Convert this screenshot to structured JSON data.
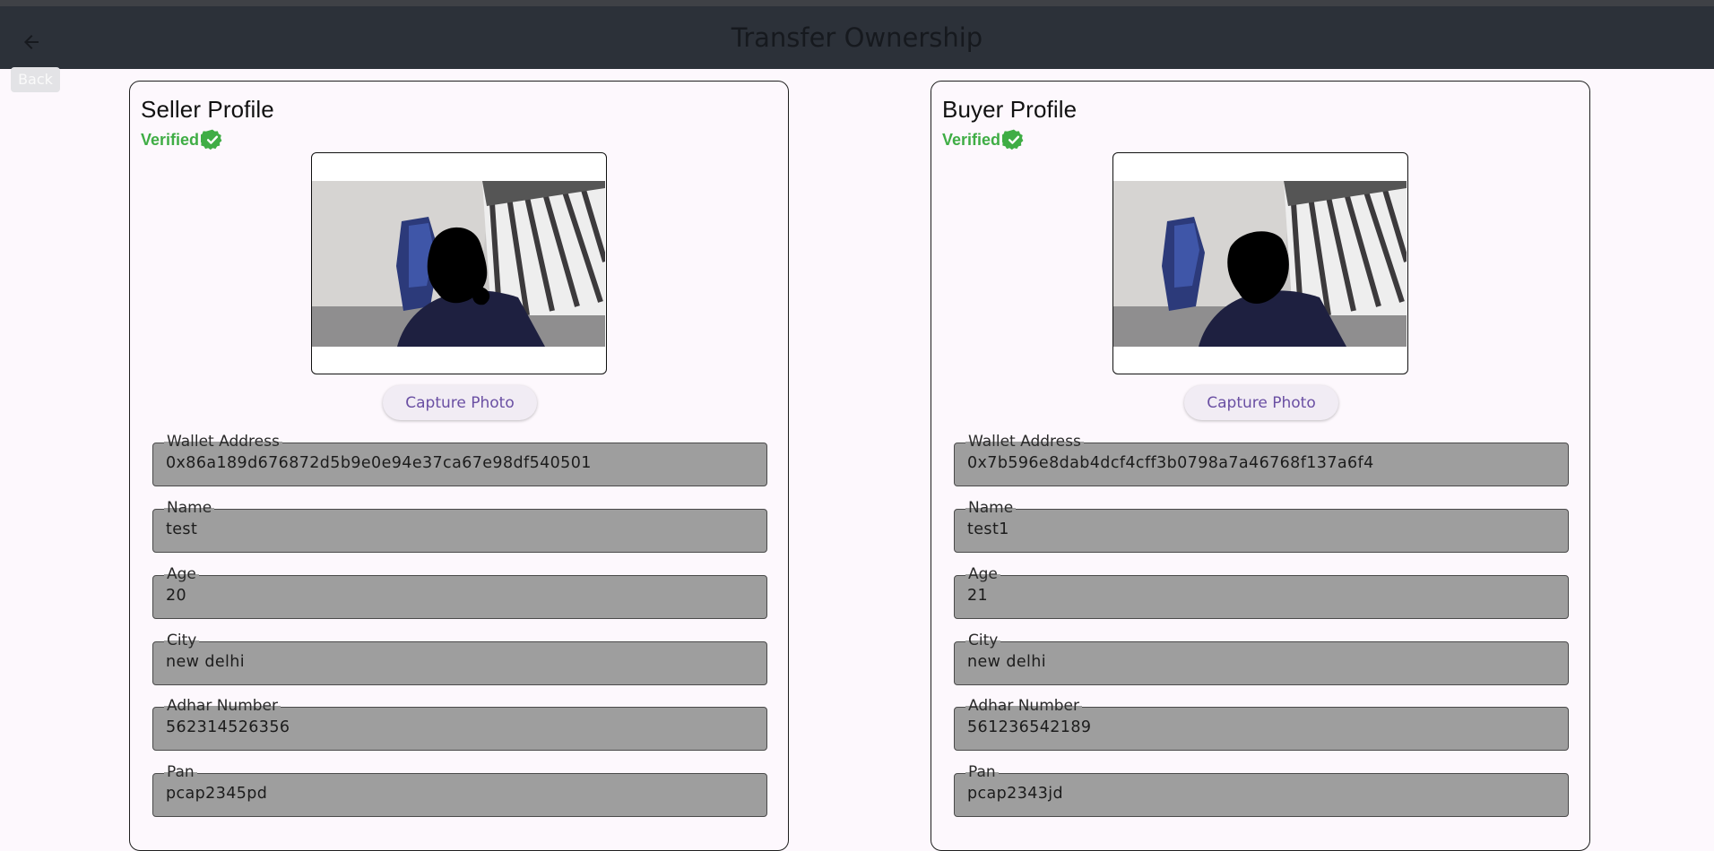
{
  "appbar": {
    "title": "Transfer Ownership",
    "back_tooltip": "Back"
  },
  "seller": {
    "title": "Seller Profile",
    "verified_label": "Verified",
    "capture_label": "Capture Photo",
    "fields": [
      {
        "label": "Wallet Address",
        "value": "0x86a189d676872d5b9e0e94e37ca67e98df540501"
      },
      {
        "label": "Name",
        "value": "test"
      },
      {
        "label": "Age",
        "value": "20"
      },
      {
        "label": "City",
        "value": "new delhi"
      },
      {
        "label": "Adhar Number",
        "value": "562314526356"
      },
      {
        "label": "Pan",
        "value": "pcap2345pd"
      }
    ]
  },
  "buyer": {
    "title": "Buyer Profile",
    "verified_label": "Verified",
    "capture_label": "Capture Photo",
    "fields": [
      {
        "label": "Wallet Address",
        "value": "0x7b596e8dab4dcf4cff3b0798a7a46768f137a6f4"
      },
      {
        "label": "Name",
        "value": "test1"
      },
      {
        "label": "Age",
        "value": "21"
      },
      {
        "label": "City",
        "value": "new delhi"
      },
      {
        "label": "Adhar Number",
        "value": "561236542189"
      },
      {
        "label": "Pan",
        "value": "pcap2343jd"
      }
    ]
  },
  "colors": {
    "verified": "#3fad45",
    "appbar": "#2c3139",
    "field_fill": "#9e9e9e",
    "button_text": "#6a4fa3"
  },
  "icons": {
    "back": "arrow-left-icon",
    "verified": "verified-badge-icon"
  }
}
